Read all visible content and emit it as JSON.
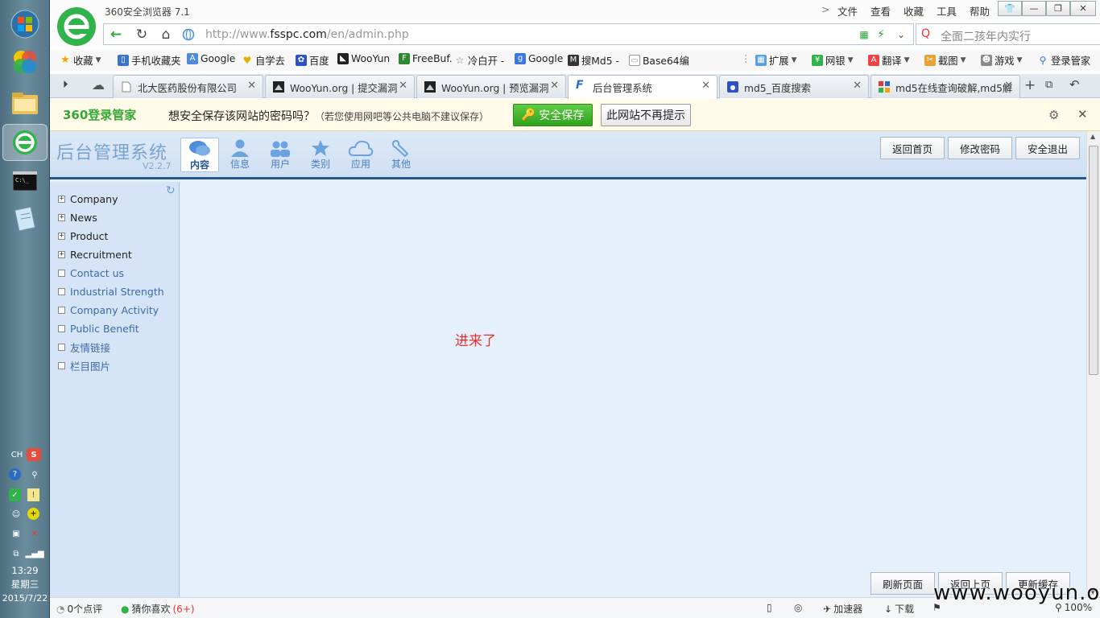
{
  "window": {
    "title": "360安全浏览器 7.1",
    "menus": [
      "文件",
      "查看",
      "收藏",
      "工具",
      "帮助"
    ]
  },
  "address": {
    "scheme": "http://www.",
    "domain": "fsspc.com",
    "path": "/en/admin.php"
  },
  "search": {
    "placeholder": "全面二孩年内实行"
  },
  "favorites": [
    "收藏",
    "手机收藏夹",
    "Google",
    "自学去",
    "百度",
    "WooYun",
    "FreeBuf.",
    "冷白开 -",
    "Google",
    "搜Md5 -",
    "Base64编"
  ],
  "extensions": [
    "扩展",
    "网银",
    "翻译",
    "截图",
    "游戏",
    "登录管家"
  ],
  "tabs": [
    {
      "label": "北大医药股份有限公司"
    },
    {
      "label": "WooYun.org | 提交漏洞"
    },
    {
      "label": "WooYun.org | 预览漏洞"
    },
    {
      "label": "后台管理系统"
    },
    {
      "label": "md5_百度搜索"
    },
    {
      "label": "md5在线查询破解,md5解"
    }
  ],
  "password_bar": {
    "brand": "360登录管家",
    "question": "想安全保存该网站的密码吗？",
    "hint": "（若您使用网吧等公共电脑不建议保存）",
    "save": "安全保存",
    "never": "此网站不再提示"
  },
  "admin": {
    "title": "后台管理系统",
    "version": "V2.2.7",
    "nav": [
      "内容",
      "信息",
      "用户",
      "类别",
      "应用",
      "其他"
    ],
    "header_buttons": [
      "返回首页",
      "修改密码",
      "安全退出"
    ],
    "sidebar": [
      "Company",
      "News",
      "Product",
      "Recruitment",
      "Contact us",
      "Industrial Strength",
      "Company Activity",
      "Public Benefit",
      "友情链接",
      "栏目图片"
    ],
    "message": "进来了",
    "footer_buttons": [
      "刷新页面",
      "返回上页",
      "更新缓存"
    ]
  },
  "status": {
    "comments": "0个点评",
    "likes": "猜你喜欢",
    "likes_count": "(6+)",
    "accelerator": "加速器",
    "download": "下载",
    "zoom": "100%"
  },
  "clock": {
    "time": "13:29",
    "weekday": "星期三",
    "date": "2015/7/22"
  },
  "tray": {
    "lang": "CH"
  },
  "watermark": "www.wooyun.org"
}
